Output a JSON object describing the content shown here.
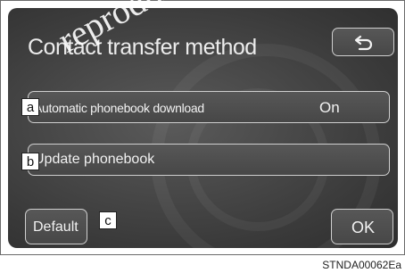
{
  "screen": {
    "title": "Contact transfer method",
    "back_icon": "back-arrow-icon"
  },
  "settings": [
    {
      "marker": "a",
      "label": "Automatic phonebook download",
      "value": "On"
    },
    {
      "marker": "b",
      "label": "Update phonebook"
    }
  ],
  "footer": {
    "default_label": "Default",
    "marker": "c",
    "ok_label": "OK"
  },
  "document": {
    "code": "STNDA00062Ea",
    "watermark_text": "reprodu"
  }
}
